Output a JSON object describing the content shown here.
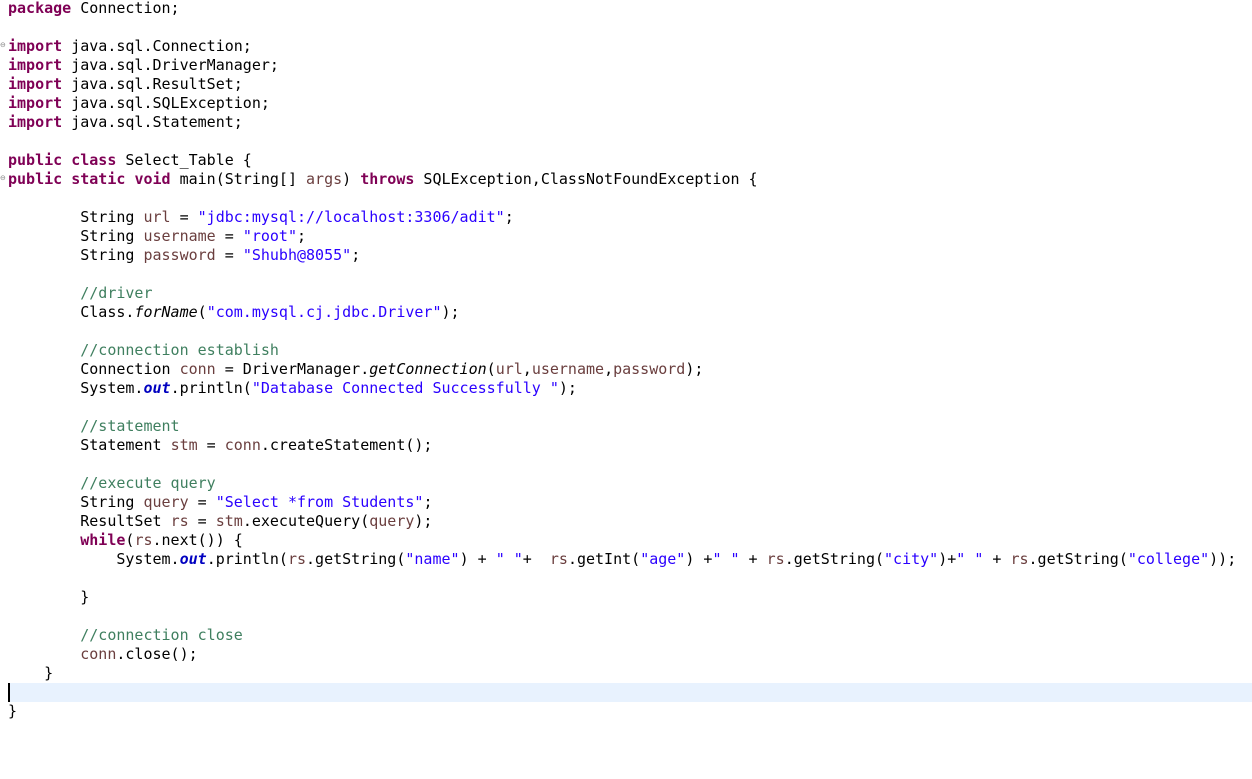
{
  "editor": {
    "language": "java",
    "lines": [
      "package Connection;",
      "",
      "import java.sql.Connection;",
      "import java.sql.DriverManager;",
      "import java.sql.ResultSet;",
      "import java.sql.SQLException;",
      "import java.sql.Statement;",
      "",
      "public class Select_Table {",
      "public static void main(String[] args) throws SQLException,ClassNotFoundException {",
      "",
      "        String url = \"jdbc:mysql://localhost:3306/adit\";",
      "        String username = \"root\";",
      "        String password = \"Shubh@8055\";",
      "",
      "        //driver",
      "        Class.forName(\"com.mysql.cj.jdbc.Driver\");",
      "",
      "        //connection establish",
      "        Connection conn = DriverManager.getConnection(url,username,password);",
      "        System.out.println(\"Database Connected Successfully \");",
      "",
      "        //statement",
      "        Statement stm = conn.createStatement();",
      "",
      "        //execute query",
      "        String query = \"Select *from Students\";",
      "        ResultSet rs = stm.executeQuery(query);",
      "        while(rs.next()) {",
      "            System.out.println(rs.getString(\"name\") + \" \"+  rs.getInt(\"age\") +\" \" + rs.getString(\"city\")+\" \" + rs.getString(\"college\"));",
      "",
      "        }",
      "",
      "        //connection close",
      "        conn.close();",
      "    }",
      "",
      "}"
    ],
    "current_line_index": 36,
    "colors": {
      "keyword": "#7f0055",
      "string": "#2a00ff",
      "comment": "#3f7f5f",
      "local_variable": "#6a3e3e",
      "static_field": "#0000c0",
      "current_line_highlight": "#e8f2fe"
    }
  }
}
